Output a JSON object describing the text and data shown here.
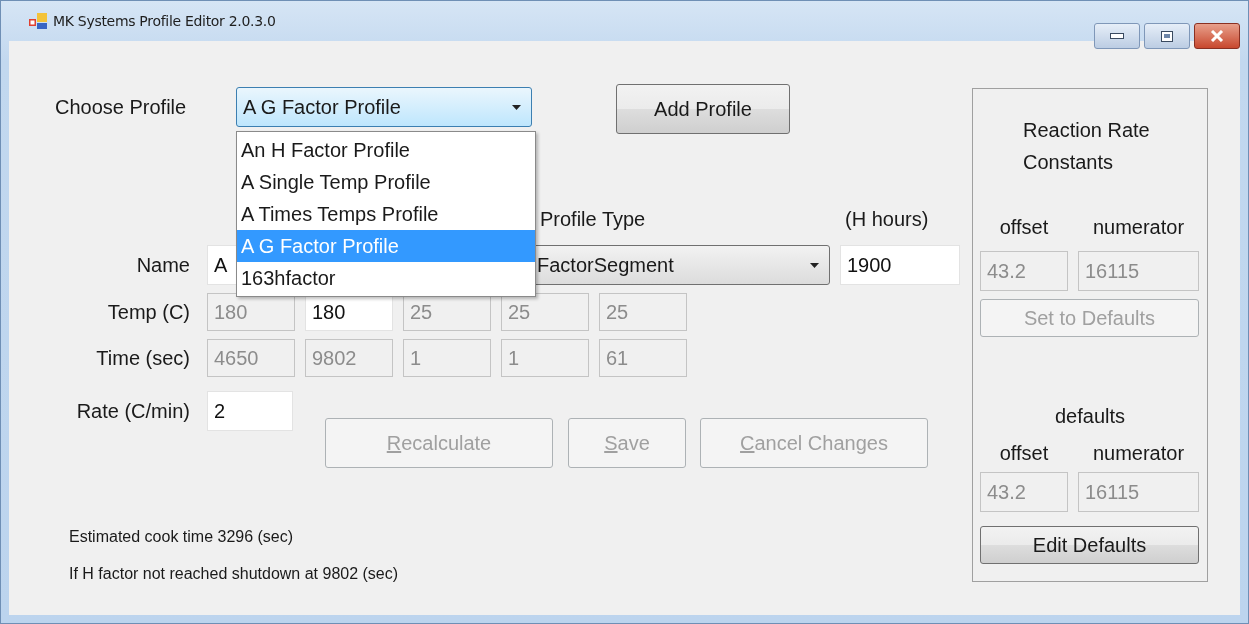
{
  "window": {
    "title": "MK Systems Profile Editor 2.0.3.0"
  },
  "choose_profile": {
    "label": "Choose Profile",
    "value": "A G Factor Profile",
    "open": true,
    "options": [
      {
        "label": "An H Factor Profile",
        "selected": false
      },
      {
        "label": "A Single Temp Profile",
        "selected": false
      },
      {
        "label": "A Times Temps Profile",
        "selected": false
      },
      {
        "label": "A G Factor Profile",
        "selected": true
      },
      {
        "label": "163hfactor",
        "selected": false
      }
    ]
  },
  "add_profile_button": {
    "label": "Add Profile"
  },
  "profile_type": {
    "label": "Profile Type",
    "value": "FactorSegment"
  },
  "h_hours": {
    "label": "(H hours)",
    "value": "1900",
    "disabled": false
  },
  "name": {
    "label": "Name",
    "value": "A",
    "disabled": false
  },
  "rows": [
    {
      "label": "Temp (C)",
      "fields": [
        {
          "value": "180",
          "disabled": true
        },
        {
          "value": "180",
          "disabled": false
        },
        {
          "value": "25",
          "disabled": true
        },
        {
          "value": "25",
          "disabled": true
        },
        {
          "value": "25",
          "disabled": true
        }
      ]
    },
    {
      "label": "Time (sec)",
      "fields": [
        {
          "value": "4650",
          "disabled": true
        },
        {
          "value": "9802",
          "disabled": true
        },
        {
          "value": "1",
          "disabled": true
        },
        {
          "value": "1",
          "disabled": true
        },
        {
          "value": "61",
          "disabled": true
        }
      ]
    }
  ],
  "rate": {
    "label": "Rate (C/min)",
    "value": "2",
    "disabled": false
  },
  "actions": [
    {
      "label": "Recalculate",
      "disabled": true
    },
    {
      "label": "Save",
      "disabled": true
    },
    {
      "label": "Cancel Changes",
      "disabled": true
    }
  ],
  "notes": [
    "Estimated cook time 3296 (sec)",
    "If H factor not reached shutdown at 9802 (sec)"
  ],
  "constants": {
    "title": "Reaction Rate Constants",
    "columns": [
      "offset",
      "numerator"
    ],
    "fields": [
      {
        "value": "43.2",
        "disabled": true
      },
      {
        "value": "16115",
        "disabled": true
      }
    ],
    "set_button": {
      "label": "Set to Defaults",
      "disabled": true
    },
    "defaults_label": "defaults",
    "default_columns": [
      "offset",
      "numerator"
    ],
    "default_fields": [
      {
        "value": "43.2",
        "disabled": true
      },
      {
        "value": "16115",
        "disabled": true
      }
    ],
    "edit_button": {
      "label": "Edit Defaults",
      "disabled": false
    }
  }
}
